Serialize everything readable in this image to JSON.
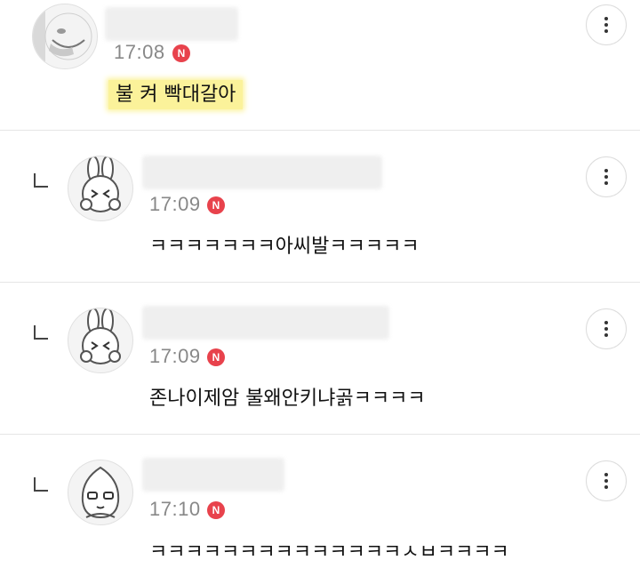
{
  "comments": [
    {
      "time": "17:08",
      "badge": "N",
      "text": "불 켜 빡대갈아"
    },
    {
      "time": "17:09",
      "badge": "N",
      "text": "ㅋㅋㅋㅋㅋㅋㅋ아씨발ㅋㅋㅋㅋㅋ"
    },
    {
      "time": "17:09",
      "badge": "N",
      "text": "존나이제암 불왜안키냐곩ㅋㅋㅋㅋ"
    },
    {
      "time": "17:10",
      "badge": "N",
      "text": "ㅋㅋㅋㅋㅋㅋㅋㅋㅋㅋㅋㅋㅋㅋㅅㅂㅋㅋㅋㅋ"
    }
  ],
  "icons": {
    "more": "more-vertical-icon",
    "reply": "reply-arrow-icon",
    "new_badge": "new-badge-icon"
  },
  "colors": {
    "badge": "#e8424c",
    "highlight": "#fbf29a",
    "time": "#888888"
  }
}
